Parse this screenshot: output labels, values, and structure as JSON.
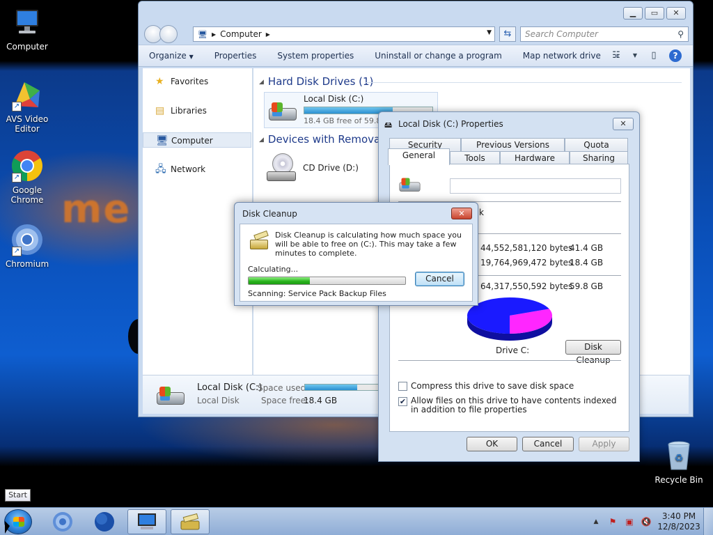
{
  "desktop": {
    "icons": [
      {
        "label": "Computer"
      },
      {
        "label": "AVS Video Editor"
      },
      {
        "label": "Google Chrome"
      },
      {
        "label": "Chromium"
      },
      {
        "label": "Recycle Bin"
      }
    ],
    "wallpaper_text": "me"
  },
  "explorer": {
    "breadcrumb": "Computer",
    "search_placeholder": "Search Computer",
    "toolbar": {
      "organize": "Organize",
      "properties": "Properties",
      "system_properties": "System properties",
      "uninstall": "Uninstall or change a program",
      "map_network": "Map network drive",
      "more": "»"
    },
    "nav": {
      "favorites": "Favorites",
      "libraries": "Libraries",
      "computer": "Computer",
      "network": "Network"
    },
    "groups": {
      "hdd": "Hard Disk Drives (1)",
      "removable": "Devices with Removable Storage"
    },
    "drives": {
      "c_name": "Local Disk (C:)",
      "c_free": "18.4 GB free of 59.8 GB",
      "c_used_fraction": 0.69,
      "d_name": "CD Drive (D:)"
    },
    "details": {
      "name": "Local Disk (C:)",
      "type": "Local Disk",
      "space_used_label": "Space used:",
      "space_free_label": "Space free:",
      "space_free_value": "18.4 GB"
    }
  },
  "properties": {
    "title": "Local Disk (C:) Properties",
    "tabs": {
      "security": "Security",
      "previous_versions": "Previous Versions",
      "quota": "Quota",
      "general": "General",
      "tools": "Tools",
      "hardware": "Hardware",
      "sharing": "Sharing"
    },
    "type_fragment": "k",
    "used_bytes": "44,552,581,120 bytes",
    "used_gb": "41.4 GB",
    "free_bytes": "19,764,969,472 bytes",
    "free_gb": "18.4 GB",
    "capacity_bytes": "64,317,550,592 bytes",
    "capacity_gb": "59.8 GB",
    "used_fraction": 0.69,
    "used_color": "#1a1aff",
    "free_color": "#ff26ff",
    "drive_label": "Drive C:",
    "disk_cleanup_btn": "Disk Cleanup",
    "compress_label": "Compress this drive to save disk space",
    "compress_checked": false,
    "index_label": "Allow files on this drive to have contents indexed in addition to file properties",
    "index_checked": true,
    "ok": "OK",
    "cancel": "Cancel",
    "apply": "Apply"
  },
  "cleanup": {
    "title": "Disk Cleanup",
    "message": "Disk Cleanup is calculating how much space you will be able to free on  (C:). This may take a few minutes to complete.",
    "calculating": "Calculating...",
    "progress_fraction": 0.39,
    "cancel": "Cancel",
    "scanning": "Scanning:   Service Pack Backup Files"
  },
  "taskbar": {
    "start_tip": "Start",
    "time": "3:40 PM",
    "date": "12/8/2023"
  }
}
